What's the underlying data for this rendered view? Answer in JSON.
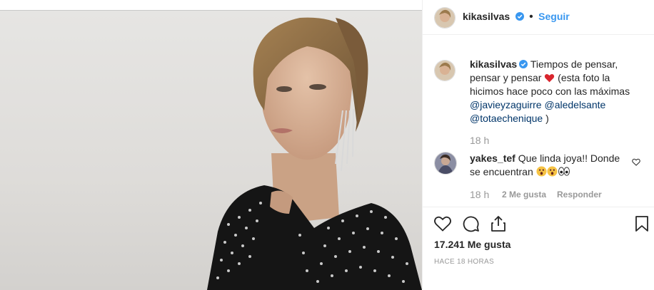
{
  "post": {
    "username": "kikasilvas",
    "follow_label": "Seguir",
    "separator": "•",
    "caption": {
      "text_1": "Tiempos de pensar, pensar y pensar",
      "text_2": " (esta foto la hicimos hace poco con las máximas ",
      "mention_1": "@javieyzaguirre",
      "mention_2": "@aledelsante",
      "mention_3": "@totaechenique",
      "close": " )"
    },
    "caption_time": "18 h",
    "comment": {
      "username": "yakes_tef",
      "text": "Que linda joya!! Donde se encuentran",
      "time": "18 h",
      "likes": "2 Me gusta",
      "reply_label": "Responder"
    },
    "likes_count": "17.241 Me gusta",
    "posted_ago": "HACE 18 HORAS"
  },
  "icons": {
    "heart": "heart-icon",
    "comment": "comment-icon",
    "share": "share-icon",
    "bookmark": "bookmark-icon",
    "verified": "verified-badge-icon"
  },
  "colors": {
    "link_blue": "#3897f0",
    "mention": "#003569",
    "verified": "#3897f0",
    "heart_red": "#ed4956"
  }
}
